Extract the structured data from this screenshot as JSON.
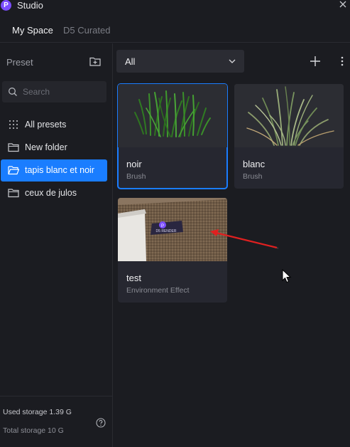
{
  "app": {
    "title": "Studio",
    "logo_letter": "P"
  },
  "tabs": [
    {
      "label": "My Space",
      "active": true
    },
    {
      "label": "D5 Curated",
      "active": false
    }
  ],
  "sidebar": {
    "preset_label": "Preset",
    "search_placeholder": "Search",
    "items": [
      {
        "label": "All presets",
        "icon": "grid-icon",
        "selected": false
      },
      {
        "label": "New folder",
        "icon": "folder-icon",
        "selected": false
      },
      {
        "label": "tapis blanc et noir",
        "icon": "folder-icon",
        "selected": true
      },
      {
        "label": "ceux de julos",
        "icon": "folder-icon",
        "selected": false
      }
    ],
    "storage": {
      "used": "Used storage 1.39 G",
      "total": "Total storage 10 G"
    }
  },
  "main": {
    "filter_value": "All",
    "cards": [
      {
        "name": "noir",
        "type": "Brush",
        "selected": true,
        "thumb": "dark-grass"
      },
      {
        "name": "blanc",
        "type": "Brush",
        "selected": false,
        "thumb": "light-grass"
      },
      {
        "name": "test",
        "type": "Environment Effect",
        "selected": false,
        "thumb": "floor-render"
      }
    ],
    "thumb_badge_text": "D5 RENDER"
  },
  "colors": {
    "accent": "#1a7dff",
    "background": "#1b1c21",
    "panel": "#262730",
    "logo": "#7b4dff",
    "annotation_arrow": "#e02020"
  }
}
